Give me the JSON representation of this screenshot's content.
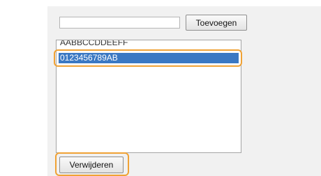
{
  "form": {
    "address_input_value": "",
    "add_button_label": "Toevoegen",
    "remove_button_label": "Verwijderen"
  },
  "list": {
    "items": [
      {
        "label": "AABBCCDDEEFF",
        "selected": false
      },
      {
        "label": "0123456789AB",
        "selected": true
      }
    ]
  },
  "colors": {
    "highlight": "#f0a235",
    "selection": "#3a78c3",
    "panel_bg": "#f1f1f1"
  }
}
